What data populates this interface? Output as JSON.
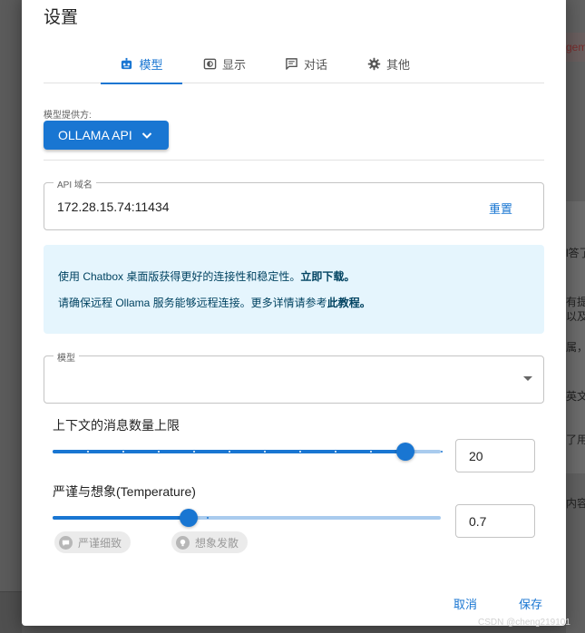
{
  "background": {
    "right_fragments": [
      "gem",
      "l答了",
      "有提",
      "以及加",
      "属，",
      "英文",
      "了用",
      "内容"
    ]
  },
  "dialog": {
    "title": "设置",
    "tabs": [
      {
        "label": "模型",
        "icon": "robot-icon",
        "active": true
      },
      {
        "label": "显示",
        "icon": "display-icon",
        "active": false
      },
      {
        "label": "对话",
        "icon": "chat-icon",
        "active": false
      },
      {
        "label": "其他",
        "icon": "gear-icon",
        "active": false
      }
    ],
    "provider": {
      "label": "模型提供方:",
      "value": "OLLAMA API"
    },
    "api_host": {
      "label": "API 域名",
      "value": "172.28.15.74:11434",
      "reset_label": "重置"
    },
    "info": {
      "line1_text": "使用 Chatbox 桌面版获得更好的连接性和稳定性。",
      "line1_link": "立即下载。",
      "line2_text": "请确保远程 Ollama 服务能够远程连接。更多详情请参考",
      "line2_link": "此教程。"
    },
    "model": {
      "label": "模型",
      "value": ""
    },
    "context_limit": {
      "label": "上下文的消息数量上限",
      "value": "20",
      "fraction": 0.91
    },
    "temperature": {
      "label": "严谨与想象(Temperature)",
      "value": "0.7",
      "fraction": 0.35,
      "chip_left": "严谨细致",
      "chip_right": "想象发散"
    },
    "cancel_label": "取消",
    "save_label": "保存"
  },
  "watermark": "CSDN @cheng219101",
  "colors": {
    "accent": "#1976d2",
    "info_bg": "#e5f5fd",
    "info_text": "#014361"
  }
}
